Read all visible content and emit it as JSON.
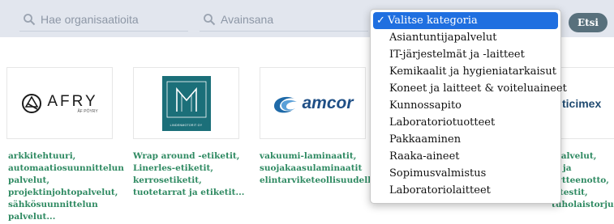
{
  "search": {
    "org_placeholder": "Hae organisaatioita",
    "keyword_placeholder": "Avainsana",
    "button_label": "Etsi"
  },
  "category_dropdown": {
    "selected": "Valitse kategoria",
    "check": "✓",
    "options": [
      "Asiantuntijapalvelut",
      "IT-järjestelmät ja -laitteet",
      "Kemikaalit ja hygieniatarkaisut",
      "Koneet ja laitteet & voiteluaineet",
      "Kunnossapito",
      "Laboratoriotuotteet",
      "Pakkaaminen",
      "Raaka-aineet",
      "Sopimusvalmistus",
      "Laboratoriolaitteet"
    ]
  },
  "cards": [
    {
      "logo_text": "AFRY",
      "logo_subtext": "ÅF PÖYRY",
      "description": "arkkitehtuuri,\nautomaatiosuunnittelun\npalvelut,\nprojektinjohtopalvelut,\nsähkösuunnittelun\npalvelut..."
    },
    {
      "logo_text": "LINDENMOTORIT OY",
      "description": "Wrap around -etiketit,\nLinerles-etiketit,\nkerrosetiketit,\ntuotetarrat ja etiketit..."
    },
    {
      "logo_text": "amcor",
      "description": "vakuumi-laminaatit,\nsuojakaasulaminaatit\nelintarviketeollisuudelle"
    },
    {
      "logo_text": "ticimex",
      "description": "-palvelut,\ns- ja\näytteenotto,\nsitestit,\ntuholaistorjunta"
    }
  ],
  "colors": {
    "search_bg": "#e2e6ee",
    "button_bg": "#58707c",
    "link_green": "#2f8a62",
    "teal_logo": "#1b6f79",
    "amcor_blue": "#1f6aa8",
    "dropdown_selected": "#1f6fe0"
  }
}
